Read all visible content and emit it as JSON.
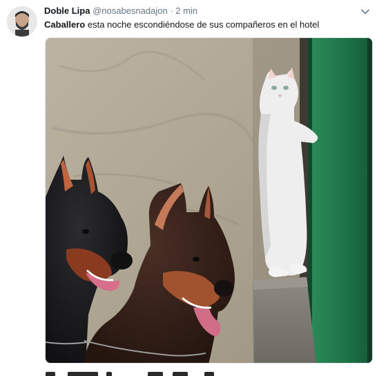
{
  "tweet": {
    "display_name": "Doble Lipa",
    "handle": "@nosabesnadajon",
    "separator": "·",
    "time": "2 min",
    "text_bold": "Caballero",
    "text_rest": " esta noche escondiéndose de sus compañeros en el hotel"
  },
  "icons": {
    "menu": "chevron-down-icon",
    "avatar": "user-avatar"
  },
  "colors": {
    "name": "#14171a",
    "secondary": "#657786",
    "door_green": "#1f7a4a",
    "wall": "#b5aa98"
  }
}
